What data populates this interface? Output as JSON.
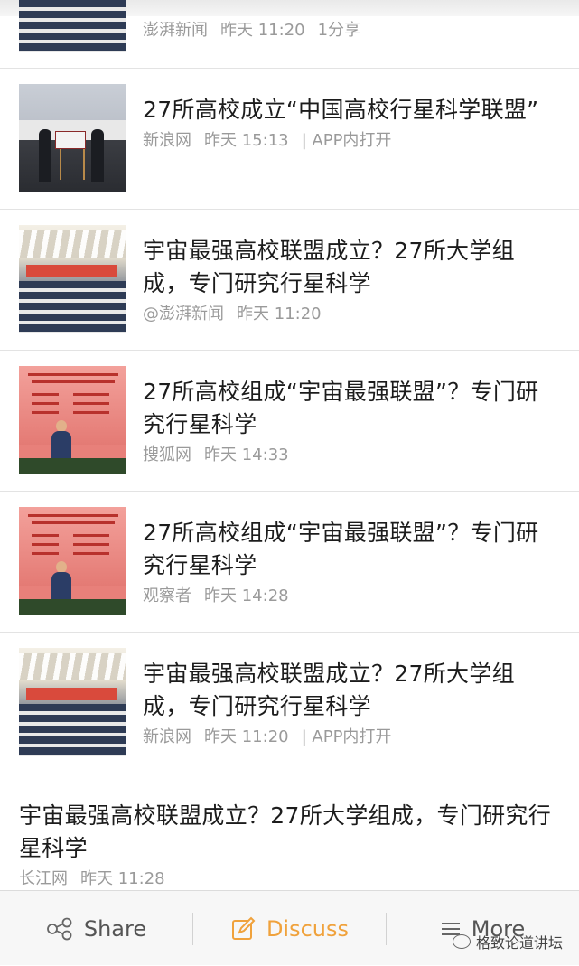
{
  "feed": {
    "items": [
      {
        "title": "",
        "source": "澎湃新闻",
        "time": "昨天 11:20",
        "extra": "1分享"
      },
      {
        "title": "27所高校成立“中国高校行星科学联盟”",
        "source": "新浪网",
        "time": "昨天 15:13",
        "extra": "| APP内打开"
      },
      {
        "title": "宇宙最强高校联盟成立？27所大学组成，专门研究行星科学",
        "source": "@澎湃新闻",
        "time": "昨天 11:20",
        "extra": ""
      },
      {
        "title": "27所高校组成“宇宙最强联盟”？专门研究行星科学",
        "source": "搜狐网",
        "time": "昨天 14:33",
        "extra": ""
      },
      {
        "title": "27所高校组成“宇宙最强联盟”？专门研究行星科学",
        "source": "观察者",
        "time": "昨天 14:28",
        "extra": ""
      },
      {
        "title": "宇宙最强高校联盟成立？27所大学组成，专门研究行星科学",
        "source": "新浪网",
        "time": "昨天 11:20",
        "extra": "| APP内打开"
      },
      {
        "title": "宇宙最强高校联盟成立？27所大学组成，专门研究行星科学",
        "source": "长江网",
        "time": "昨天 11:28",
        "extra": ""
      }
    ]
  },
  "toolbar": {
    "share_label": "Share",
    "discuss_label": "Discuss",
    "more_label": "More",
    "discuss_color": "#f0a23c"
  },
  "watermark": {
    "text": "格致论道讲坛"
  },
  "icons": {
    "share": "share-icon",
    "discuss": "edit-icon",
    "more": "menu-icon"
  }
}
